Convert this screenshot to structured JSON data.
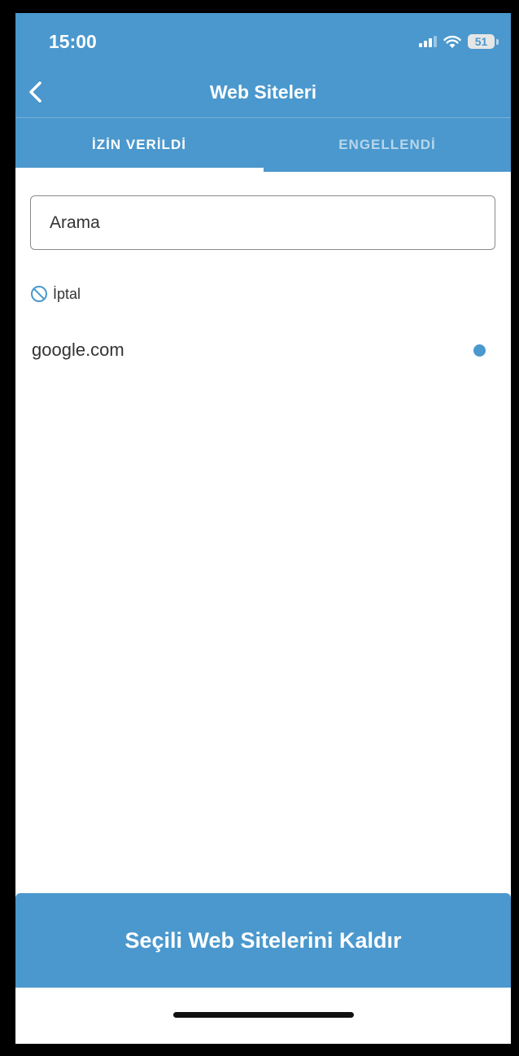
{
  "status_bar": {
    "time": "15:00",
    "battery": "51",
    "icons": [
      "signal-icon",
      "wifi-icon",
      "battery-icon"
    ]
  },
  "header": {
    "back_icon": "chevron-left-icon",
    "title": "Web Siteleri"
  },
  "tabs": [
    {
      "label": "İZİN VERİLDİ",
      "active": true
    },
    {
      "label": "ENGELLENDİ",
      "active": false
    }
  ],
  "search": {
    "placeholder": "Arama",
    "value": ""
  },
  "cancel": {
    "icon": "prohibited-icon",
    "label": "İptal"
  },
  "sites": [
    {
      "name": "google.com",
      "selected": true
    }
  ],
  "footer": {
    "remove_button_label": "Seçili Web Sitelerini Kaldır"
  },
  "colors": {
    "accent": "#4a98cd",
    "text": "#333333",
    "background": "#ffffff"
  }
}
